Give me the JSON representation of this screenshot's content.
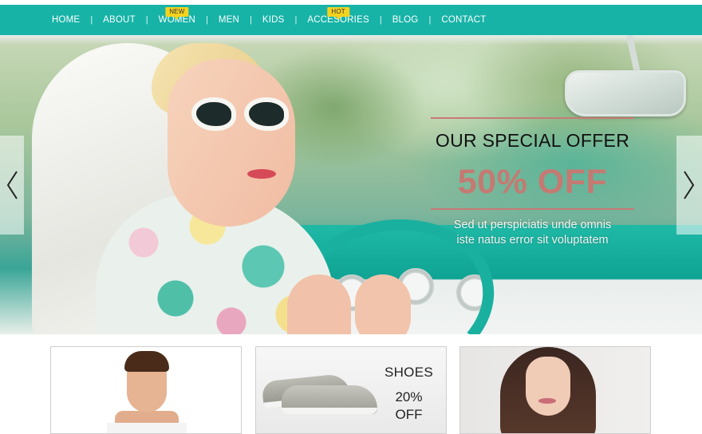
{
  "nav": {
    "items": [
      {
        "label": "HOME",
        "badge": ""
      },
      {
        "label": "ABOUT",
        "badge": ""
      },
      {
        "label": "WOMEN",
        "badge": "New"
      },
      {
        "label": "MEN",
        "badge": ""
      },
      {
        "label": "KIDS",
        "badge": ""
      },
      {
        "label": "ACCESORIES",
        "badge": "Hot"
      },
      {
        "label": "BLOG",
        "badge": ""
      },
      {
        "label": "CONTACT",
        "badge": ""
      }
    ],
    "separator": "|"
  },
  "hero": {
    "title": "OUR SPECIAL OFFER",
    "discount": "50% OFF",
    "description_line1": "Sed ut perspiciatis unde omnis",
    "description_line2": "iste natus error sit voluptatem",
    "prev_icon": "chevron-left-icon",
    "next_icon": "chevron-right-icon"
  },
  "cards": [
    {
      "title": "",
      "discount": ""
    },
    {
      "title": "SHOES",
      "discount_line1": "20%",
      "discount_line2": "OFF"
    },
    {
      "title": "",
      "discount": ""
    }
  ],
  "colors": {
    "nav_bg": "#17b3a7",
    "badge": "#f4d21f",
    "offer_accent": "#c47a72"
  }
}
